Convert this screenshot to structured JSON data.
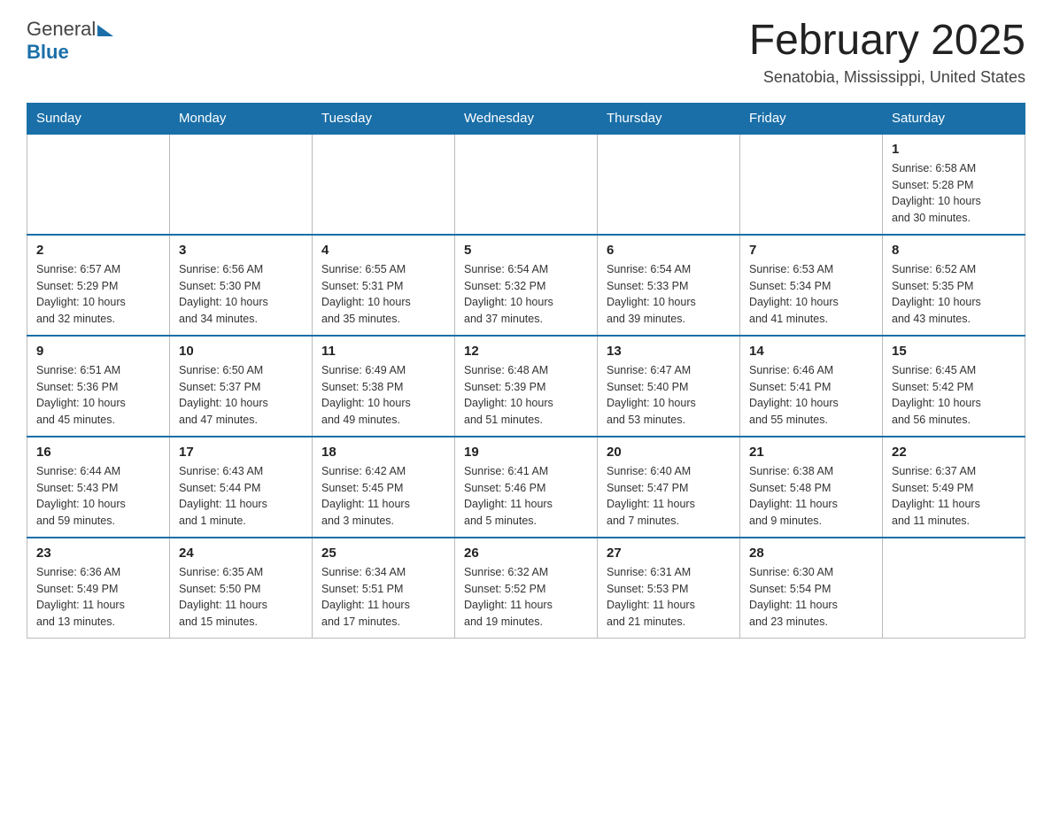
{
  "header": {
    "logo_general": "General",
    "logo_blue": "Blue",
    "month_title": "February 2025",
    "location": "Senatobia, Mississippi, United States"
  },
  "days_of_week": [
    "Sunday",
    "Monday",
    "Tuesday",
    "Wednesday",
    "Thursday",
    "Friday",
    "Saturday"
  ],
  "weeks": [
    [
      {
        "day": "",
        "info": ""
      },
      {
        "day": "",
        "info": ""
      },
      {
        "day": "",
        "info": ""
      },
      {
        "day": "",
        "info": ""
      },
      {
        "day": "",
        "info": ""
      },
      {
        "day": "",
        "info": ""
      },
      {
        "day": "1",
        "info": "Sunrise: 6:58 AM\nSunset: 5:28 PM\nDaylight: 10 hours\nand 30 minutes."
      }
    ],
    [
      {
        "day": "2",
        "info": "Sunrise: 6:57 AM\nSunset: 5:29 PM\nDaylight: 10 hours\nand 32 minutes."
      },
      {
        "day": "3",
        "info": "Sunrise: 6:56 AM\nSunset: 5:30 PM\nDaylight: 10 hours\nand 34 minutes."
      },
      {
        "day": "4",
        "info": "Sunrise: 6:55 AM\nSunset: 5:31 PM\nDaylight: 10 hours\nand 35 minutes."
      },
      {
        "day": "5",
        "info": "Sunrise: 6:54 AM\nSunset: 5:32 PM\nDaylight: 10 hours\nand 37 minutes."
      },
      {
        "day": "6",
        "info": "Sunrise: 6:54 AM\nSunset: 5:33 PM\nDaylight: 10 hours\nand 39 minutes."
      },
      {
        "day": "7",
        "info": "Sunrise: 6:53 AM\nSunset: 5:34 PM\nDaylight: 10 hours\nand 41 minutes."
      },
      {
        "day": "8",
        "info": "Sunrise: 6:52 AM\nSunset: 5:35 PM\nDaylight: 10 hours\nand 43 minutes."
      }
    ],
    [
      {
        "day": "9",
        "info": "Sunrise: 6:51 AM\nSunset: 5:36 PM\nDaylight: 10 hours\nand 45 minutes."
      },
      {
        "day": "10",
        "info": "Sunrise: 6:50 AM\nSunset: 5:37 PM\nDaylight: 10 hours\nand 47 minutes."
      },
      {
        "day": "11",
        "info": "Sunrise: 6:49 AM\nSunset: 5:38 PM\nDaylight: 10 hours\nand 49 minutes."
      },
      {
        "day": "12",
        "info": "Sunrise: 6:48 AM\nSunset: 5:39 PM\nDaylight: 10 hours\nand 51 minutes."
      },
      {
        "day": "13",
        "info": "Sunrise: 6:47 AM\nSunset: 5:40 PM\nDaylight: 10 hours\nand 53 minutes."
      },
      {
        "day": "14",
        "info": "Sunrise: 6:46 AM\nSunset: 5:41 PM\nDaylight: 10 hours\nand 55 minutes."
      },
      {
        "day": "15",
        "info": "Sunrise: 6:45 AM\nSunset: 5:42 PM\nDaylight: 10 hours\nand 56 minutes."
      }
    ],
    [
      {
        "day": "16",
        "info": "Sunrise: 6:44 AM\nSunset: 5:43 PM\nDaylight: 10 hours\nand 59 minutes."
      },
      {
        "day": "17",
        "info": "Sunrise: 6:43 AM\nSunset: 5:44 PM\nDaylight: 11 hours\nand 1 minute."
      },
      {
        "day": "18",
        "info": "Sunrise: 6:42 AM\nSunset: 5:45 PM\nDaylight: 11 hours\nand 3 minutes."
      },
      {
        "day": "19",
        "info": "Sunrise: 6:41 AM\nSunset: 5:46 PM\nDaylight: 11 hours\nand 5 minutes."
      },
      {
        "day": "20",
        "info": "Sunrise: 6:40 AM\nSunset: 5:47 PM\nDaylight: 11 hours\nand 7 minutes."
      },
      {
        "day": "21",
        "info": "Sunrise: 6:38 AM\nSunset: 5:48 PM\nDaylight: 11 hours\nand 9 minutes."
      },
      {
        "day": "22",
        "info": "Sunrise: 6:37 AM\nSunset: 5:49 PM\nDaylight: 11 hours\nand 11 minutes."
      }
    ],
    [
      {
        "day": "23",
        "info": "Sunrise: 6:36 AM\nSunset: 5:49 PM\nDaylight: 11 hours\nand 13 minutes."
      },
      {
        "day": "24",
        "info": "Sunrise: 6:35 AM\nSunset: 5:50 PM\nDaylight: 11 hours\nand 15 minutes."
      },
      {
        "day": "25",
        "info": "Sunrise: 6:34 AM\nSunset: 5:51 PM\nDaylight: 11 hours\nand 17 minutes."
      },
      {
        "day": "26",
        "info": "Sunrise: 6:32 AM\nSunset: 5:52 PM\nDaylight: 11 hours\nand 19 minutes."
      },
      {
        "day": "27",
        "info": "Sunrise: 6:31 AM\nSunset: 5:53 PM\nDaylight: 11 hours\nand 21 minutes."
      },
      {
        "day": "28",
        "info": "Sunrise: 6:30 AM\nSunset: 5:54 PM\nDaylight: 11 hours\nand 23 minutes."
      },
      {
        "day": "",
        "info": ""
      }
    ]
  ]
}
